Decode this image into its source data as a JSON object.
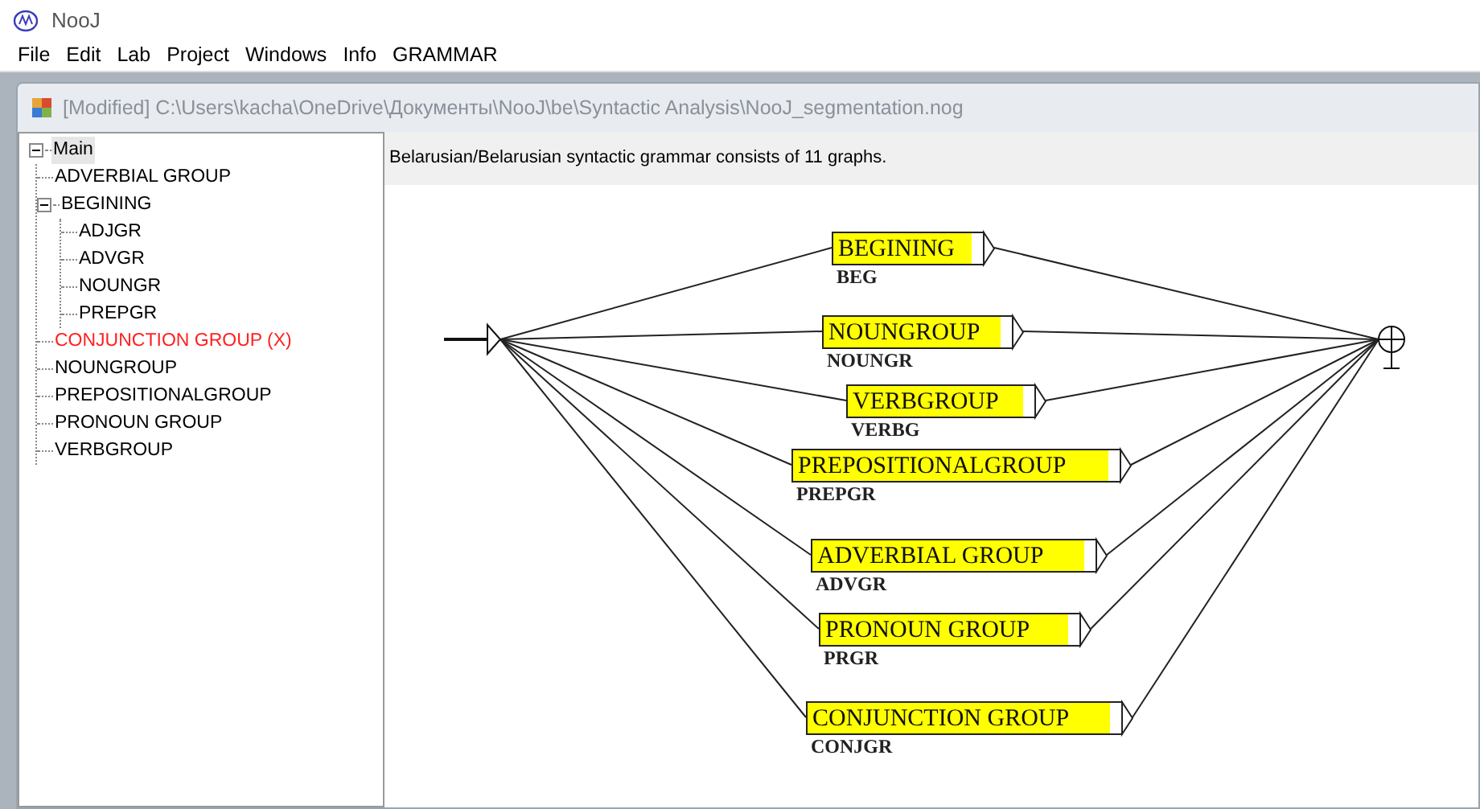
{
  "app": {
    "title": "NooJ"
  },
  "menu": [
    "File",
    "Edit",
    "Lab",
    "Project",
    "Windows",
    "Info",
    "GRAMMAR"
  ],
  "document": {
    "title": "[Modified] C:\\Users\\kacha\\OneDrive\\Документы\\NooJ\\be\\Syntactic Analysis\\NooJ_segmentation.nog"
  },
  "tree": [
    {
      "label": "Main",
      "selected": true,
      "invalid": false,
      "expanded": true,
      "children": [
        {
          "label": "ADVERBIAL GROUP",
          "selected": false,
          "invalid": false
        },
        {
          "label": "BEGINING",
          "selected": false,
          "invalid": false,
          "expanded": true,
          "children": [
            {
              "label": "ADJGR",
              "selected": false,
              "invalid": false
            },
            {
              "label": "ADVGR",
              "selected": false,
              "invalid": false
            },
            {
              "label": "NOUNGR",
              "selected": false,
              "invalid": false
            },
            {
              "label": "PREPGR",
              "selected": false,
              "invalid": false
            }
          ]
        },
        {
          "label": "CONJUNCTION GROUP (X)",
          "selected": false,
          "invalid": true
        },
        {
          "label": "NOUNGROUP",
          "selected": false,
          "invalid": false
        },
        {
          "label": "PREPOSITIONALGROUP",
          "selected": false,
          "invalid": false
        },
        {
          "label": "PRONOUN GROUP",
          "selected": false,
          "invalid": false
        },
        {
          "label": "VERBGROUP",
          "selected": false,
          "invalid": false
        }
      ]
    }
  ],
  "info": "Belarusian/Belarusian syntactic grammar consists of 11 graphs.",
  "graph": {
    "nodes": [
      {
        "label": "BEGINING",
        "output": "BEG"
      },
      {
        "label": "NOUNGROUP",
        "output": "NOUNGR"
      },
      {
        "label": "VERBGROUP",
        "output": "VERBG"
      },
      {
        "label": "PREPOSITIONALGROUP",
        "output": "PREPGR"
      },
      {
        "label": "ADVERBIAL GROUP",
        "output": "ADVGR"
      },
      {
        "label": "PRONOUN GROUP",
        "output": "PRGR"
      },
      {
        "label": "CONJUNCTION GROUP",
        "output": "CONJGR"
      }
    ]
  }
}
